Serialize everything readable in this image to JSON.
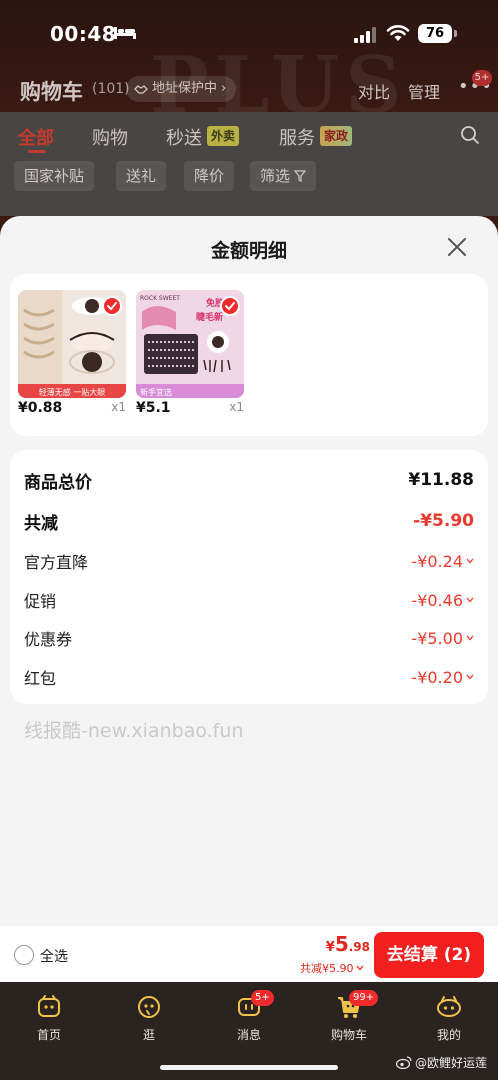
{
  "status_bar": {
    "time": "00:48",
    "battery": "76"
  },
  "header": {
    "title": "购物车",
    "count": "(101)",
    "address_protect": "地址保护中",
    "compare": "对比",
    "manage": "管理",
    "more_badge": "5+"
  },
  "tabs": [
    {
      "label": "全部",
      "active": true
    },
    {
      "label": "购物",
      "active": false
    },
    {
      "label": "秒送",
      "active": false,
      "tag": "外卖"
    },
    {
      "label": "服务",
      "active": false,
      "tag": "家政"
    }
  ],
  "filters": [
    "国家补贴",
    "送礼",
    "降价",
    "筛选"
  ],
  "sheet": {
    "title": "金额明细",
    "products": [
      {
        "price": "¥0.88",
        "qty": "x1",
        "img_text": "轻薄无感 一贴大眼"
      },
      {
        "price": "¥5.1",
        "qty": "x1",
        "img_brand": "ROCK SWEET",
        "img_text_top": "免胶",
        "img_text_mid": "睫毛新",
        "img_text_bottom": "新手宜选"
      }
    ],
    "rows": [
      {
        "label": "商品总价",
        "value": "¥11.88",
        "style": "total"
      },
      {
        "label": "共减",
        "value": "-¥5.90",
        "style": "strong"
      },
      {
        "label": "官方直降",
        "value": "-¥0.24",
        "expandable": true
      },
      {
        "label": "促销",
        "value": "-¥0.46",
        "expandable": true
      },
      {
        "label": "优惠券",
        "value": "-¥5.00",
        "expandable": true
      },
      {
        "label": "红包",
        "value": "-¥0.20",
        "expandable": true
      }
    ],
    "watermark": "线报酷-new.xianbao.fun"
  },
  "checkout": {
    "select_all": "全选",
    "currency": "¥",
    "total_int": "5",
    "total_dec": ".98",
    "saved": "共减¥5.90",
    "pay_label": "去结算 (2)"
  },
  "tabbar": [
    {
      "label": "首页",
      "icon": "home-icon"
    },
    {
      "label": "逛",
      "icon": "browse-icon"
    },
    {
      "label": "消息",
      "icon": "message-icon",
      "badge": "5+"
    },
    {
      "label": "购物车",
      "icon": "cart-icon",
      "badge": "99+"
    },
    {
      "label": "我的",
      "icon": "profile-icon"
    }
  ],
  "weibo_handle": "@欧鲤好运莲",
  "colors": {
    "accent_red": "#f21f1f",
    "discount_red": "#e83a2c",
    "sheet_bg": "#f4f4f4"
  }
}
